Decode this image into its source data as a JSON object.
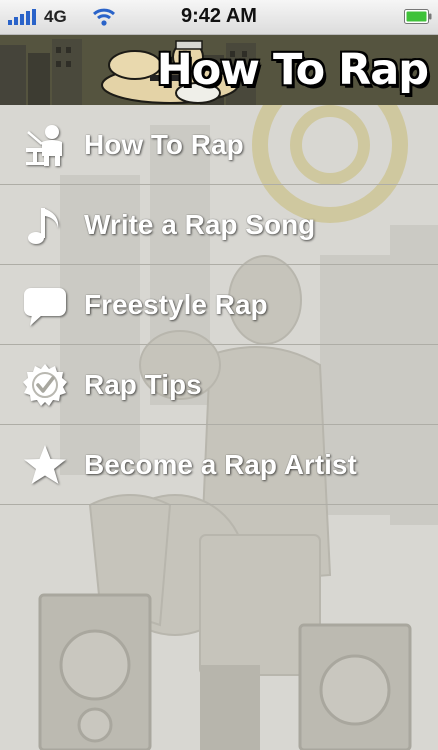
{
  "status_bar": {
    "carrier": "4G",
    "time": "9:42 AM"
  },
  "header": {
    "logo_text": "How To Rap"
  },
  "menu": {
    "items": [
      {
        "label": "How To Rap",
        "icon": "teacher-icon"
      },
      {
        "label": "Write a Rap Song",
        "icon": "music-note-icon"
      },
      {
        "label": "Freestyle Rap",
        "icon": "speech-bubble-icon"
      },
      {
        "label": "Rap Tips",
        "icon": "checkmark-badge-icon"
      },
      {
        "label": "Become a Rap Artist",
        "icon": "star-icon"
      }
    ]
  },
  "colors": {
    "menu_text": "#ffffff",
    "content_background": "#d8d7d2",
    "divider": "#aeada6",
    "battery": "#3fc23a"
  }
}
